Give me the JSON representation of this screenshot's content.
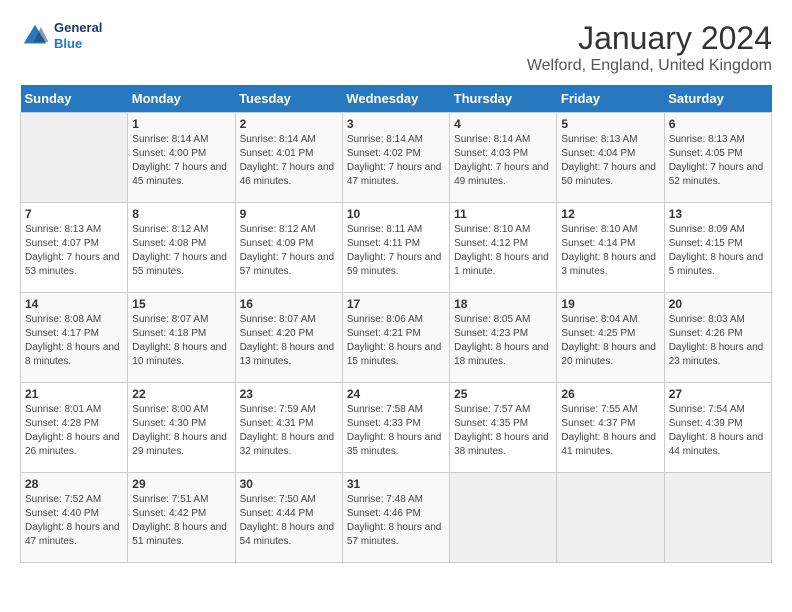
{
  "header": {
    "logo_general": "General",
    "logo_blue": "Blue",
    "title": "January 2024",
    "subtitle": "Welford, England, United Kingdom"
  },
  "calendar": {
    "days_of_week": [
      "Sunday",
      "Monday",
      "Tuesday",
      "Wednesday",
      "Thursday",
      "Friday",
      "Saturday"
    ],
    "weeks": [
      [
        {
          "day": "",
          "sunrise": "",
          "sunset": "",
          "daylight": ""
        },
        {
          "day": "1",
          "sunrise": "Sunrise: 8:14 AM",
          "sunset": "Sunset: 4:00 PM",
          "daylight": "Daylight: 7 hours and 45 minutes."
        },
        {
          "day": "2",
          "sunrise": "Sunrise: 8:14 AM",
          "sunset": "Sunset: 4:01 PM",
          "daylight": "Daylight: 7 hours and 46 minutes."
        },
        {
          "day": "3",
          "sunrise": "Sunrise: 8:14 AM",
          "sunset": "Sunset: 4:02 PM",
          "daylight": "Daylight: 7 hours and 47 minutes."
        },
        {
          "day": "4",
          "sunrise": "Sunrise: 8:14 AM",
          "sunset": "Sunset: 4:03 PM",
          "daylight": "Daylight: 7 hours and 49 minutes."
        },
        {
          "day": "5",
          "sunrise": "Sunrise: 8:13 AM",
          "sunset": "Sunset: 4:04 PM",
          "daylight": "Daylight: 7 hours and 50 minutes."
        },
        {
          "day": "6",
          "sunrise": "Sunrise: 8:13 AM",
          "sunset": "Sunset: 4:05 PM",
          "daylight": "Daylight: 7 hours and 52 minutes."
        }
      ],
      [
        {
          "day": "7",
          "sunrise": "Sunrise: 8:13 AM",
          "sunset": "Sunset: 4:07 PM",
          "daylight": "Daylight: 7 hours and 53 minutes."
        },
        {
          "day": "8",
          "sunrise": "Sunrise: 8:12 AM",
          "sunset": "Sunset: 4:08 PM",
          "daylight": "Daylight: 7 hours and 55 minutes."
        },
        {
          "day": "9",
          "sunrise": "Sunrise: 8:12 AM",
          "sunset": "Sunset: 4:09 PM",
          "daylight": "Daylight: 7 hours and 57 minutes."
        },
        {
          "day": "10",
          "sunrise": "Sunrise: 8:11 AM",
          "sunset": "Sunset: 4:11 PM",
          "daylight": "Daylight: 7 hours and 59 minutes."
        },
        {
          "day": "11",
          "sunrise": "Sunrise: 8:10 AM",
          "sunset": "Sunset: 4:12 PM",
          "daylight": "Daylight: 8 hours and 1 minute."
        },
        {
          "day": "12",
          "sunrise": "Sunrise: 8:10 AM",
          "sunset": "Sunset: 4:14 PM",
          "daylight": "Daylight: 8 hours and 3 minutes."
        },
        {
          "day": "13",
          "sunrise": "Sunrise: 8:09 AM",
          "sunset": "Sunset: 4:15 PM",
          "daylight": "Daylight: 8 hours and 5 minutes."
        }
      ],
      [
        {
          "day": "14",
          "sunrise": "Sunrise: 8:08 AM",
          "sunset": "Sunset: 4:17 PM",
          "daylight": "Daylight: 8 hours and 8 minutes."
        },
        {
          "day": "15",
          "sunrise": "Sunrise: 8:07 AM",
          "sunset": "Sunset: 4:18 PM",
          "daylight": "Daylight: 8 hours and 10 minutes."
        },
        {
          "day": "16",
          "sunrise": "Sunrise: 8:07 AM",
          "sunset": "Sunset: 4:20 PM",
          "daylight": "Daylight: 8 hours and 13 minutes."
        },
        {
          "day": "17",
          "sunrise": "Sunrise: 8:06 AM",
          "sunset": "Sunset: 4:21 PM",
          "daylight": "Daylight: 8 hours and 15 minutes."
        },
        {
          "day": "18",
          "sunrise": "Sunrise: 8:05 AM",
          "sunset": "Sunset: 4:23 PM",
          "daylight": "Daylight: 8 hours and 18 minutes."
        },
        {
          "day": "19",
          "sunrise": "Sunrise: 8:04 AM",
          "sunset": "Sunset: 4:25 PM",
          "daylight": "Daylight: 8 hours and 20 minutes."
        },
        {
          "day": "20",
          "sunrise": "Sunrise: 8:03 AM",
          "sunset": "Sunset: 4:26 PM",
          "daylight": "Daylight: 8 hours and 23 minutes."
        }
      ],
      [
        {
          "day": "21",
          "sunrise": "Sunrise: 8:01 AM",
          "sunset": "Sunset: 4:28 PM",
          "daylight": "Daylight: 8 hours and 26 minutes."
        },
        {
          "day": "22",
          "sunrise": "Sunrise: 8:00 AM",
          "sunset": "Sunset: 4:30 PM",
          "daylight": "Daylight: 8 hours and 29 minutes."
        },
        {
          "day": "23",
          "sunrise": "Sunrise: 7:59 AM",
          "sunset": "Sunset: 4:31 PM",
          "daylight": "Daylight: 8 hours and 32 minutes."
        },
        {
          "day": "24",
          "sunrise": "Sunrise: 7:58 AM",
          "sunset": "Sunset: 4:33 PM",
          "daylight": "Daylight: 8 hours and 35 minutes."
        },
        {
          "day": "25",
          "sunrise": "Sunrise: 7:57 AM",
          "sunset": "Sunset: 4:35 PM",
          "daylight": "Daylight: 8 hours and 38 minutes."
        },
        {
          "day": "26",
          "sunrise": "Sunrise: 7:55 AM",
          "sunset": "Sunset: 4:37 PM",
          "daylight": "Daylight: 8 hours and 41 minutes."
        },
        {
          "day": "27",
          "sunrise": "Sunrise: 7:54 AM",
          "sunset": "Sunset: 4:39 PM",
          "daylight": "Daylight: 8 hours and 44 minutes."
        }
      ],
      [
        {
          "day": "28",
          "sunrise": "Sunrise: 7:52 AM",
          "sunset": "Sunset: 4:40 PM",
          "daylight": "Daylight: 8 hours and 47 minutes."
        },
        {
          "day": "29",
          "sunrise": "Sunrise: 7:51 AM",
          "sunset": "Sunset: 4:42 PM",
          "daylight": "Daylight: 8 hours and 51 minutes."
        },
        {
          "day": "30",
          "sunrise": "Sunrise: 7:50 AM",
          "sunset": "Sunset: 4:44 PM",
          "daylight": "Daylight: 8 hours and 54 minutes."
        },
        {
          "day": "31",
          "sunrise": "Sunrise: 7:48 AM",
          "sunset": "Sunset: 4:46 PM",
          "daylight": "Daylight: 8 hours and 57 minutes."
        },
        {
          "day": "",
          "sunrise": "",
          "sunset": "",
          "daylight": ""
        },
        {
          "day": "",
          "sunrise": "",
          "sunset": "",
          "daylight": ""
        },
        {
          "day": "",
          "sunrise": "",
          "sunset": "",
          "daylight": ""
        }
      ]
    ]
  }
}
